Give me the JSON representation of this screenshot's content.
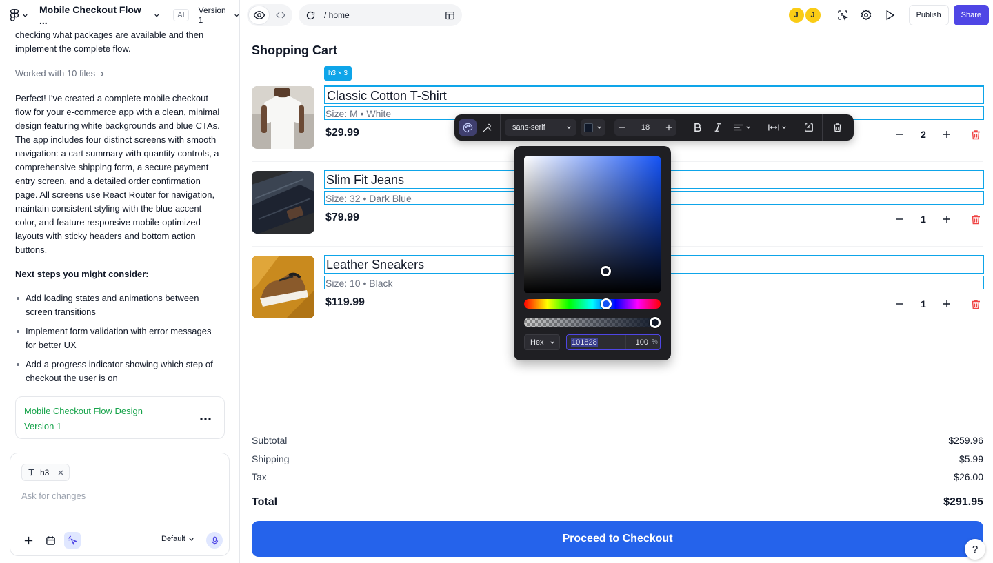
{
  "app": {
    "project_title": "Mobile Checkout Flow ...",
    "ai_badge": "AI",
    "version_label": "Version 1"
  },
  "preview_nav": {
    "path": "/ home"
  },
  "header_actions": {
    "avatars": [
      "J",
      "J"
    ],
    "publish_label": "Publish",
    "share_label": "Share"
  },
  "chat": {
    "intro": "checking what packages are available and then implement the complete flow.",
    "worked_with": "Worked with 10 files",
    "summary": "Perfect! I've created a complete mobile checkout flow for your e-commerce app with a clean, minimal design featuring white backgrounds and blue CTAs. The app includes four distinct screens with smooth navigation: a cart summary with quantity controls, a comprehensive shipping form, a secure payment entry screen, and a detailed order confirmation page. All screens use React Router for navigation, maintain consistent styling with the blue accent color, and feature responsive mobile-optimized layouts with sticky headers and bottom action buttons.",
    "next_steps_title": "Next steps you might consider:",
    "next_steps": [
      "Add loading states and animations between screen transitions",
      "Implement form validation with error messages for better UX",
      "Add a progress indicator showing which step of checkout the user is on"
    ],
    "version_card": {
      "title": "Mobile Checkout Flow Design",
      "version": "Version 1"
    }
  },
  "composer": {
    "chip_label": "h3",
    "placeholder": "Ask for changes",
    "model_label": "Default"
  },
  "cart": {
    "title": "Shopping Cart",
    "selection_badge": "h3 × 3",
    "items": [
      {
        "name": "Classic Cotton T-Shirt",
        "meta": "Size: M • White",
        "price": "$29.99",
        "qty": "2"
      },
      {
        "name": "Slim Fit Jeans",
        "meta": "Size: 32 • Dark Blue",
        "price": "$79.99",
        "qty": "1"
      },
      {
        "name": "Leather Sneakers",
        "meta": "Size: 10 • Black",
        "price": "$119.99",
        "qty": "1"
      }
    ],
    "summary": {
      "subtotal_label": "Subtotal",
      "subtotal": "$259.96",
      "shipping_label": "Shipping",
      "shipping": "$5.99",
      "tax_label": "Tax",
      "tax": "$26.00",
      "total_label": "Total",
      "total": "$291.95"
    },
    "checkout_label": "Proceed to Checkout",
    "help_label": "?"
  },
  "format_toolbar": {
    "font_family": "sans-serif",
    "font_size": "18",
    "text_color": "#101828"
  },
  "color_picker": {
    "mode": "Hex",
    "hex": "101828",
    "alpha": "100",
    "alpha_unit": "%"
  },
  "colors": {
    "accent": "#2563eb",
    "share": "#4f46e5",
    "selection": "#0ea5e9",
    "delete": "#ef4444",
    "version_card": "#16a34a"
  }
}
